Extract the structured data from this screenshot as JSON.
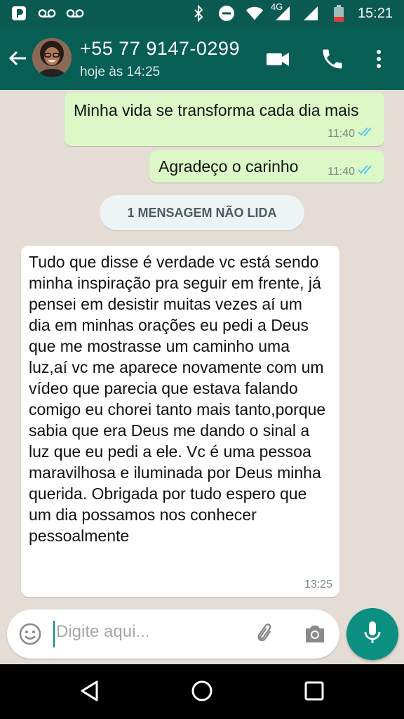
{
  "status_bar": {
    "time": "15:21",
    "network": "4G",
    "icons": [
      "p-app-icon",
      "voicemail-icon",
      "voicemail-icon",
      "bluetooth-icon",
      "dnd-icon",
      "wifi-icon",
      "signal-icon",
      "signal-icon",
      "battery-icon"
    ]
  },
  "header": {
    "contact_name": "+55 77 9147-0299",
    "last_seen": "hoje às 14:25",
    "icons": [
      "back-arrow-icon",
      "avatar",
      "video-call-icon",
      "phone-icon",
      "more-vert-icon"
    ]
  },
  "messages": [
    {
      "direction": "out",
      "text": "Minha vida se transforma cada dia mais",
      "time": "11:40",
      "status": "read"
    },
    {
      "direction": "out",
      "text": "Agradeço o carinho",
      "time": "11:40",
      "status": "read"
    },
    {
      "type": "divider",
      "text": "1 MENSAGEM NÃO LIDA"
    },
    {
      "direction": "in",
      "text": "Tudo que disse é verdade vc está sendo minha inspiração pra seguir em frente, já pensei em desistir muitas vezes aí um dia em minhas orações eu pedi a Deus que me mostrasse um caminho uma luz,aí vc me aparece novamente com um vídeo que parecia que estava falando comigo eu chorei tanto mais tanto,porque sabia que era Deus me dando o sinal a luz que eu pedi a ele. Vc é uma pessoa maravilhosa e iluminada por Deus minha querida. Obrigada por tudo espero que um dia possamos nos conhecer pessoalmente",
      "time": "13:25"
    }
  ],
  "composer": {
    "placeholder": "Digite aqui...",
    "icons": [
      "emoji-icon",
      "attach-icon",
      "camera-icon",
      "mic-icon"
    ]
  },
  "nav_bar": {
    "icons": [
      "back-nav-icon",
      "home-nav-icon",
      "recents-nav-icon"
    ]
  },
  "colors": {
    "header": "#075e54",
    "status_bar": "#0b5a52",
    "outgoing": "#dcf8c6",
    "incoming": "#ffffff",
    "background": "#e5ddd5",
    "fab": "#0b8f80",
    "read_ticks": "#4fc3f7"
  }
}
